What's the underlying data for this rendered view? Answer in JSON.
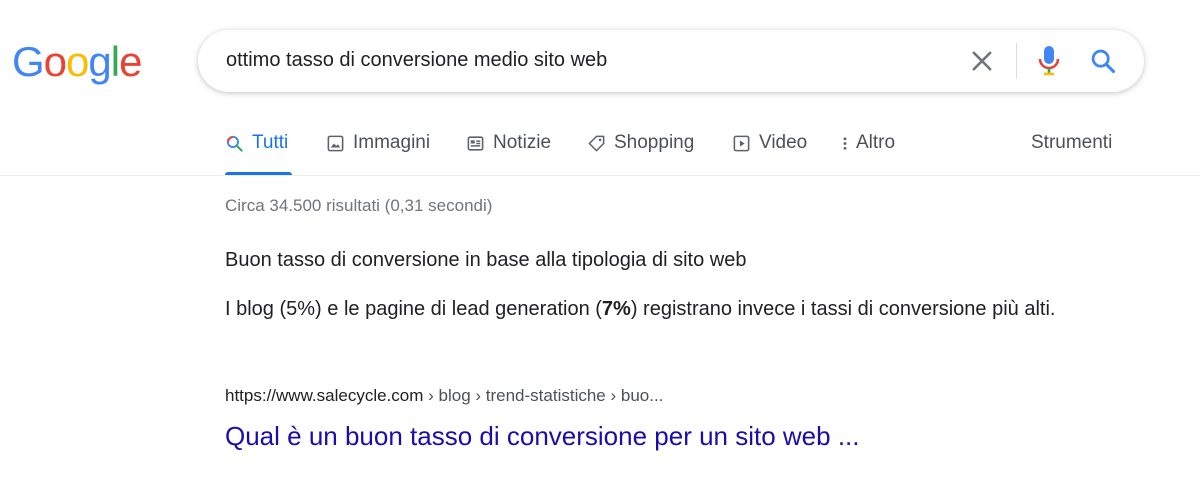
{
  "logo": {
    "letters": [
      "G",
      "o",
      "o",
      "g",
      "l",
      "e"
    ],
    "colors": [
      "#4285F4",
      "#EA4335",
      "#FBBC05",
      "#4285F4",
      "#34A853",
      "#EA4335"
    ]
  },
  "search": {
    "query": "ottimo tasso di conversione medio sito web"
  },
  "tabs": [
    {
      "label": "Tutti",
      "icon": "search-icon",
      "active": true
    },
    {
      "label": "Immagini",
      "icon": "image-icon"
    },
    {
      "label": "Notizie",
      "icon": "news-icon"
    },
    {
      "label": "Shopping",
      "icon": "tag-icon"
    },
    {
      "label": "Video",
      "icon": "play-icon"
    },
    {
      "label": "Altro",
      "icon": "more-vert-icon"
    }
  ],
  "tools_label": "Strumenti",
  "stats": "Circa 34.500 risultati (0,31 secondi)",
  "snippet": {
    "title": "Buon tasso di conversione in base alla tipologia di sito web",
    "body_before": "I blog (5%) e le pagine di lead generation (",
    "body_bold": "7%",
    "body_after": ") registrano invece i tassi di conversione più alti."
  },
  "result": {
    "url_domain": "https://www.salecycle.com",
    "url_crumbs": " › blog › trend-statistiche › buo...",
    "title": "Qual è un buon tasso di conversione per un sito web ..."
  },
  "colors": {
    "link": "#1a0dab",
    "accent": "#1a73e8"
  }
}
